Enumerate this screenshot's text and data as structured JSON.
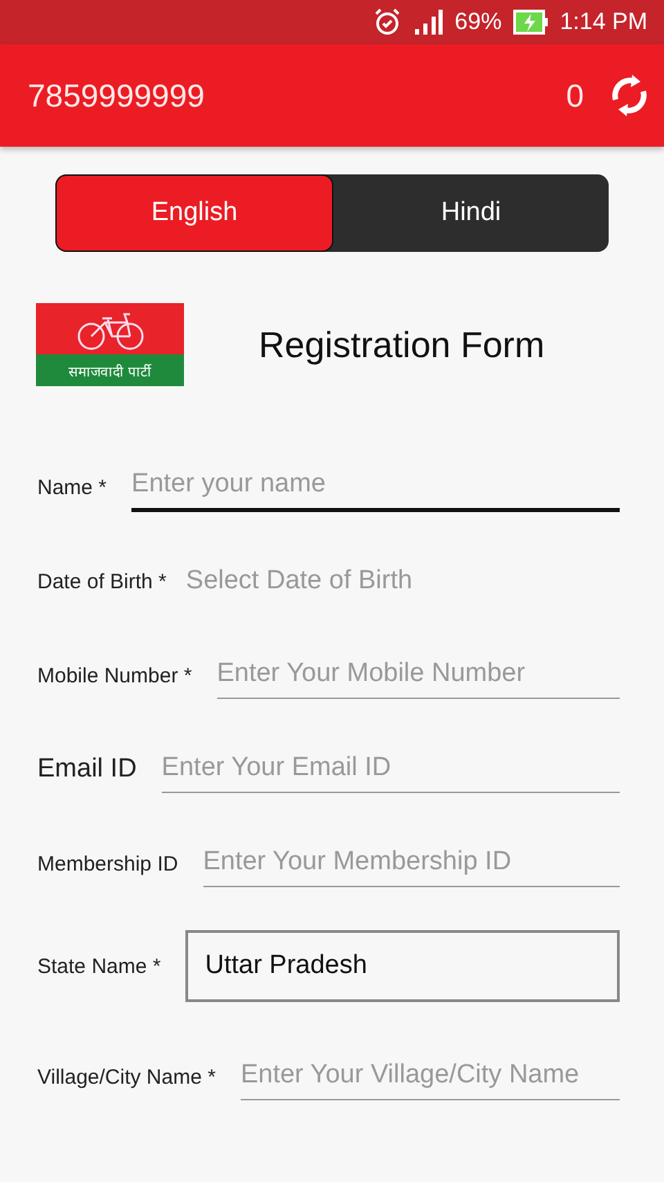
{
  "status_bar": {
    "battery": "69%",
    "time": "1:14 PM"
  },
  "app_bar": {
    "phone": "7859999999",
    "count": "0"
  },
  "tabs": [
    {
      "label": "English",
      "selected": true
    },
    {
      "label": "Hindi",
      "selected": false
    }
  ],
  "header": {
    "logo_caption": "समाजवादी पार्टी",
    "title": "Registration Form"
  },
  "fields": [
    {
      "label": "Name *",
      "kind": "input",
      "placeholder": "Enter your name",
      "focused": true
    },
    {
      "label": "Date of Birth *",
      "kind": "date",
      "placeholder": "Select Date of Birth",
      "focused": false
    },
    {
      "label": "Mobile Number *",
      "kind": "input",
      "placeholder": "Enter Your Mobile Number",
      "focused": false
    },
    {
      "label": "Email ID",
      "kind": "input",
      "placeholder": "Enter Your Email ID",
      "focused": false,
      "large_label": true
    },
    {
      "label": "Membership ID",
      "kind": "input",
      "placeholder": "Enter Your Membership ID",
      "focused": false
    },
    {
      "label": "State Name *",
      "kind": "select",
      "value": "Uttar Pradesh",
      "focused": false
    },
    {
      "label": "Village/City Name *",
      "kind": "input",
      "placeholder": "Enter Your Village/City Name",
      "focused": false
    }
  ]
}
